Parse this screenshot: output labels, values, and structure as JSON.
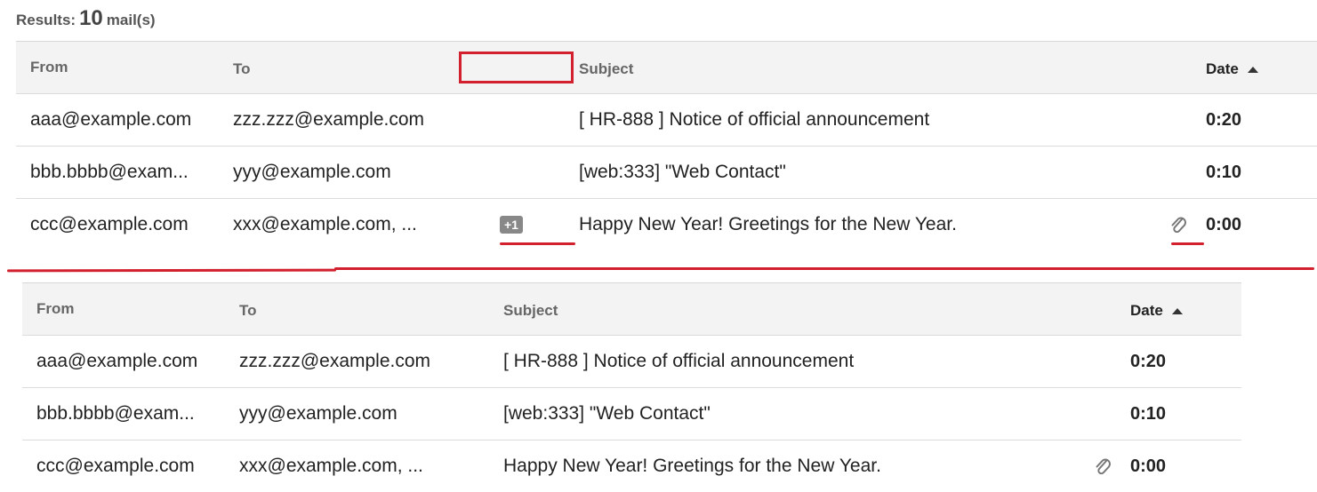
{
  "results": {
    "prefix": "Results:",
    "count": "10",
    "suffix": "mail(s)"
  },
  "columns": {
    "from": "From",
    "to": "To",
    "subject": "Subject",
    "date": "Date"
  },
  "table_top": {
    "rows": [
      {
        "from": "aaa@example.com",
        "to": "zzz.zzz@example.com",
        "badge": "",
        "subject": "[ HR-888 ] Notice of official announcement",
        "attachment": false,
        "date": "0:20"
      },
      {
        "from": "bbb.bbbb@exam...",
        "to": "yyy@example.com",
        "badge": "",
        "subject": "[web:333] \"Web Contact\"",
        "attachment": false,
        "date": "0:10"
      },
      {
        "from": "ccc@example.com",
        "to": "xxx@example.com, ...",
        "badge": "+1",
        "subject": "Happy New Year! Greetings for the New Year.",
        "attachment": true,
        "date": "0:00"
      }
    ]
  },
  "table_bottom": {
    "rows": [
      {
        "from": "aaa@example.com",
        "to": "zzz.zzz@example.com",
        "subject": "[ HR-888 ] Notice of official announcement",
        "attachment": false,
        "date": "0:20"
      },
      {
        "from": "bbb.bbbb@exam...",
        "to": "yyy@example.com",
        "subject": "[web:333] \"Web Contact\"",
        "attachment": false,
        "date": "0:10"
      },
      {
        "from": "ccc@example.com",
        "to": "xxx@example.com, ...",
        "subject": "Happy New Year! Greetings for the New Year.",
        "attachment": true,
        "date": "0:00"
      }
    ]
  },
  "icons": {
    "attachment": "paperclip-icon",
    "sort": "sort-ascending-icon"
  },
  "colors": {
    "annotation": "#d3202e",
    "badge_bg": "#888888",
    "header_bg": "#f3f3f3"
  }
}
